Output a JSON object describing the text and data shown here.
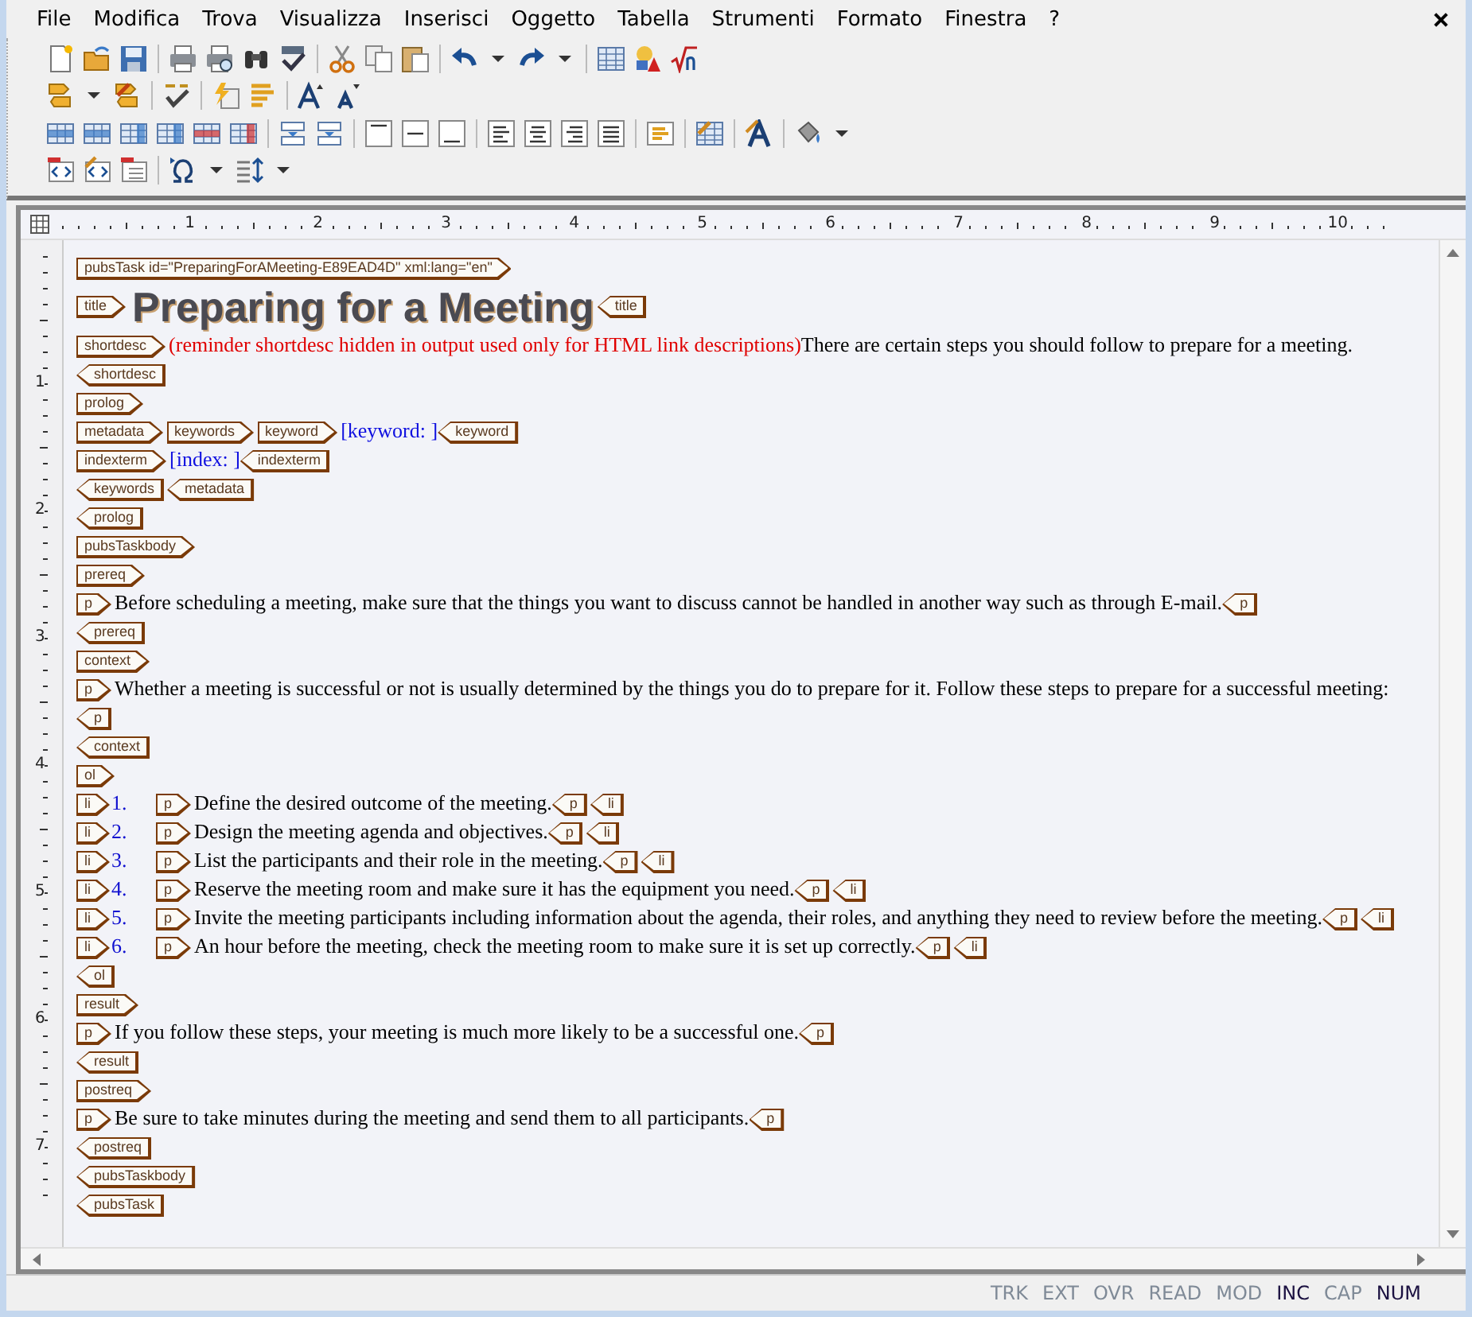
{
  "menu": [
    "File",
    "Modifica",
    "Trova",
    "Visualizza",
    "Inserisci",
    "Oggetto",
    "Tabella",
    "Strumenti",
    "Formato",
    "Finestra",
    "?"
  ],
  "ruler": {
    "columns": [
      "1",
      "2",
      "3",
      "4",
      "5",
      "6",
      "7",
      "8",
      "9",
      "10"
    ],
    "rows": [
      "1",
      "2",
      "3",
      "4",
      "5",
      "6",
      "7"
    ]
  },
  "document": [
    {
      "parts": [
        {
          "kind": "open",
          "text": "pubsTask id=\"PreparingForAMeeting-E89EAD4D\" xml:lang=\"en\""
        }
      ]
    },
    {
      "parts": [
        {
          "kind": "open",
          "text": "title"
        },
        {
          "kind": "heading",
          "text": "Preparing for a Meeting"
        },
        {
          "kind": "close",
          "text": "title"
        }
      ]
    },
    {
      "parts": [
        {
          "kind": "open",
          "text": "shortdesc"
        },
        {
          "kind": "note",
          "text": "(reminder shortdesc hidden in output used only for HTML link descriptions)"
        },
        {
          "kind": "body",
          "text": "There are certain steps you should follow to prepare for a meeting."
        }
      ]
    },
    {
      "parts": [
        {
          "kind": "close",
          "text": "shortdesc"
        }
      ]
    },
    {
      "parts": [
        {
          "kind": "open",
          "text": "prolog"
        }
      ]
    },
    {
      "parts": [
        {
          "kind": "open",
          "text": "metadata"
        },
        {
          "kind": "open",
          "text": "keywords"
        },
        {
          "kind": "open",
          "text": "keyword"
        },
        {
          "kind": "field",
          "text": "[keyword: ]"
        },
        {
          "kind": "close",
          "text": "keyword"
        }
      ]
    },
    {
      "parts": [
        {
          "kind": "open",
          "text": "indexterm"
        },
        {
          "kind": "field",
          "text": "[index: ]"
        },
        {
          "kind": "close",
          "text": "indexterm"
        }
      ]
    },
    {
      "parts": [
        {
          "kind": "close",
          "text": "keywords"
        },
        {
          "kind": "close",
          "text": "metadata"
        }
      ]
    },
    {
      "parts": [
        {
          "kind": "close",
          "text": "prolog"
        }
      ]
    },
    {
      "parts": [
        {
          "kind": "open",
          "text": "pubsTaskbody"
        }
      ]
    },
    {
      "parts": [
        {
          "kind": "open",
          "text": "prereq"
        }
      ]
    },
    {
      "parts": [
        {
          "kind": "open",
          "text": "p"
        },
        {
          "kind": "body",
          "text": "Before scheduling a meeting, make sure that the things you want to discuss cannot be handled in another way such as through E-mail."
        },
        {
          "kind": "close",
          "text": "p"
        }
      ]
    },
    {
      "parts": [
        {
          "kind": "close",
          "text": "prereq"
        }
      ]
    },
    {
      "parts": [
        {
          "kind": "open",
          "text": "context"
        }
      ]
    },
    {
      "parts": [
        {
          "kind": "open",
          "text": "p"
        },
        {
          "kind": "body",
          "text": "Whether a meeting is successful or not is usually determined by the things you do to prepare for it. Follow these steps to prepare for a successful meeting:"
        },
        {
          "kind": "close",
          "text": "p"
        }
      ]
    },
    {
      "parts": [
        {
          "kind": "close",
          "text": "context"
        }
      ]
    },
    {
      "parts": [
        {
          "kind": "open",
          "text": "ol"
        }
      ]
    },
    {
      "parts": [
        {
          "kind": "open",
          "text": "li"
        },
        {
          "kind": "number",
          "text": "1."
        },
        {
          "kind": "open",
          "text": "p"
        },
        {
          "kind": "body",
          "text": "Define the desired outcome of the meeting."
        },
        {
          "kind": "close",
          "text": "p"
        },
        {
          "kind": "close",
          "text": "li"
        }
      ]
    },
    {
      "parts": [
        {
          "kind": "open",
          "text": "li"
        },
        {
          "kind": "number",
          "text": "2."
        },
        {
          "kind": "open",
          "text": "p"
        },
        {
          "kind": "body",
          "text": "Design the meeting agenda and objectives."
        },
        {
          "kind": "close",
          "text": "p"
        },
        {
          "kind": "close",
          "text": "li"
        }
      ]
    },
    {
      "parts": [
        {
          "kind": "open",
          "text": "li"
        },
        {
          "kind": "number",
          "text": "3."
        },
        {
          "kind": "open",
          "text": "p"
        },
        {
          "kind": "body",
          "text": "List the participants and their role in the meeting."
        },
        {
          "kind": "close",
          "text": "p"
        },
        {
          "kind": "close",
          "text": "li"
        }
      ]
    },
    {
      "parts": [
        {
          "kind": "open",
          "text": "li"
        },
        {
          "kind": "number",
          "text": "4."
        },
        {
          "kind": "open",
          "text": "p"
        },
        {
          "kind": "body",
          "text": "Reserve the meeting room and make sure it has the equipment you need."
        },
        {
          "kind": "close",
          "text": "p"
        },
        {
          "kind": "close",
          "text": "li"
        }
      ]
    },
    {
      "parts": [
        {
          "kind": "open",
          "text": "li"
        },
        {
          "kind": "number",
          "text": "5."
        },
        {
          "kind": "open",
          "text": "p"
        },
        {
          "kind": "body",
          "text": "Invite the meeting participants including information about the agenda, their roles, and anything they need to review before the meeting."
        },
        {
          "kind": "close",
          "text": "p"
        },
        {
          "kind": "close",
          "text": "li"
        }
      ]
    },
    {
      "parts": [
        {
          "kind": "open",
          "text": "li"
        },
        {
          "kind": "number",
          "text": "6."
        },
        {
          "kind": "open",
          "text": "p"
        },
        {
          "kind": "body",
          "text": "An hour before the meeting, check the meeting room to make sure it is set up correctly."
        },
        {
          "kind": "close",
          "text": "p"
        },
        {
          "kind": "close",
          "text": "li"
        }
      ]
    },
    {
      "parts": [
        {
          "kind": "close",
          "text": "ol"
        }
      ]
    },
    {
      "parts": [
        {
          "kind": "open",
          "text": "result"
        }
      ]
    },
    {
      "parts": [
        {
          "kind": "open",
          "text": "p"
        },
        {
          "kind": "body",
          "text": "If you follow these steps, your meeting is much more likely to be a successful one."
        },
        {
          "kind": "close",
          "text": "p"
        }
      ]
    },
    {
      "parts": [
        {
          "kind": "close",
          "text": "result"
        }
      ]
    },
    {
      "parts": [
        {
          "kind": "open",
          "text": "postreq"
        }
      ]
    },
    {
      "parts": [
        {
          "kind": "open",
          "text": "p"
        },
        {
          "kind": "body",
          "text": "Be sure to take minutes during the meeting and send them to all participants."
        },
        {
          "kind": "close",
          "text": "p"
        }
      ]
    },
    {
      "parts": [
        {
          "kind": "close",
          "text": "postreq"
        }
      ]
    },
    {
      "parts": [
        {
          "kind": "close",
          "text": "pubsTaskbody"
        }
      ]
    },
    {
      "parts": [
        {
          "kind": "close",
          "text": "pubsTask"
        }
      ]
    }
  ],
  "status_bar": [
    {
      "label": "TRK",
      "on": false
    },
    {
      "label": "EXT",
      "on": false
    },
    {
      "label": "OVR",
      "on": false
    },
    {
      "label": "READ",
      "on": false
    },
    {
      "label": "MOD",
      "on": false
    },
    {
      "label": "INC",
      "on": true
    },
    {
      "label": "CAP",
      "on": false
    },
    {
      "label": "NUM",
      "on": true
    }
  ]
}
